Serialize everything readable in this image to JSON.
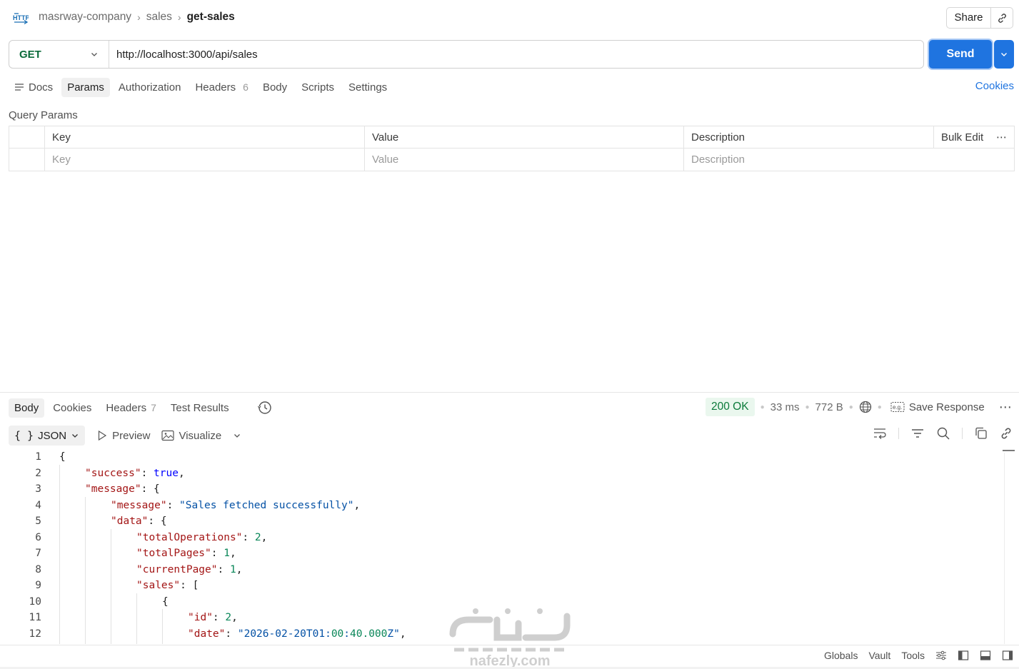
{
  "header": {
    "breadcrumb": [
      "masrway-company",
      "sales",
      "get-sales"
    ],
    "share_label": "Share"
  },
  "request": {
    "method": "GET",
    "url": "http://localhost:3000/api/sales",
    "send_label": "Send",
    "tabs": [
      {
        "label": "Docs"
      },
      {
        "label": "Params"
      },
      {
        "label": "Authorization"
      },
      {
        "label": "Headers",
        "count": "6"
      },
      {
        "label": "Body"
      },
      {
        "label": "Scripts"
      },
      {
        "label": "Settings"
      }
    ],
    "cookies_label": "Cookies"
  },
  "query_params": {
    "title": "Query Params",
    "headers": {
      "key": "Key",
      "value": "Value",
      "description": "Description",
      "bulk_edit": "Bulk Edit"
    },
    "placeholders": {
      "key": "Key",
      "value": "Value",
      "description": "Description"
    }
  },
  "response": {
    "tabs": [
      {
        "label": "Body"
      },
      {
        "label": "Cookies"
      },
      {
        "label": "Headers",
        "count": "7"
      },
      {
        "label": "Test Results"
      }
    ],
    "status": "200 OK",
    "time": "33 ms",
    "size": "772 B",
    "save_label": "Save Response",
    "format": "JSON",
    "preview_label": "Preview",
    "visualize_label": "Visualize",
    "line_numbers": [
      "1",
      "2",
      "3",
      "4",
      "5",
      "6",
      "7",
      "8",
      "9",
      "10",
      "11",
      "12"
    ],
    "body_lines": [
      "{",
      "\"success\": true,",
      "\"message\": {",
      "\"message\": \"Sales fetched successfully\",",
      "\"data\": {",
      "\"totalOperations\": 2,",
      "\"totalPages\": 1,",
      "\"currentPage\": 1,",
      "\"sales\": [",
      "{",
      "\"id\": 2,",
      "\"date\": \"2026-02-20T01:00:40.000Z\","
    ]
  },
  "footer": {
    "items": [
      "Globals",
      "Vault",
      "Tools"
    ]
  },
  "watermark": {
    "text": "nafezly.com"
  },
  "colors": {
    "accent": "#1f74e0",
    "method_get": "#0b6b3a",
    "status_ok": "#0b7a3a",
    "json_key": "#a31515",
    "json_string": "#0451a5",
    "json_number": "#098658",
    "json_bool": "#0000ff"
  }
}
